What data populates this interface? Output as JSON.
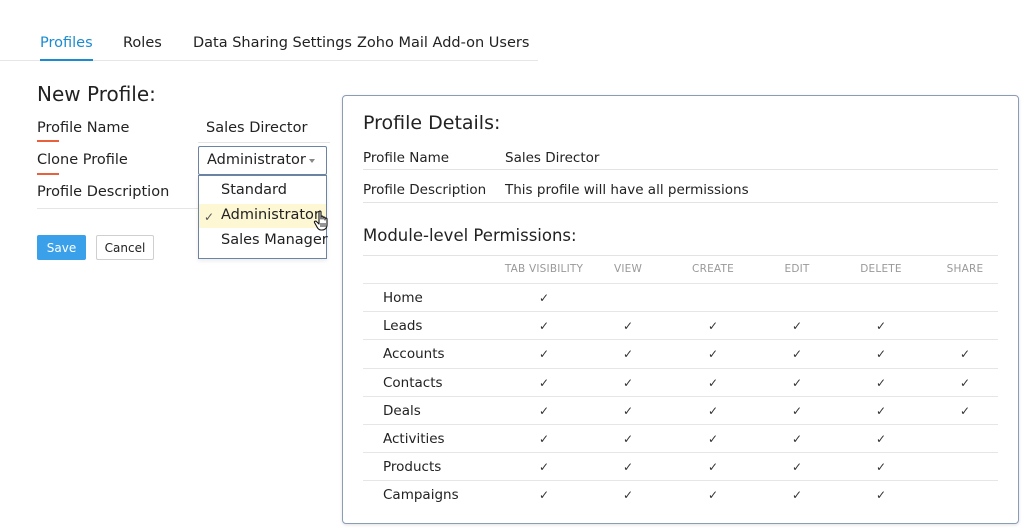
{
  "tabs": [
    {
      "label": "Profiles",
      "active": true
    },
    {
      "label": "Roles",
      "active": false
    },
    {
      "label": "Data Sharing Settings",
      "active": false
    },
    {
      "label": "Zoho Mail Add-on Users",
      "active": false
    }
  ],
  "form": {
    "title": "New Profile:",
    "profile_name_label": "Profile Name",
    "profile_name_value": "Sales Director",
    "clone_label": "Clone Profile",
    "clone_selected": "Administrator",
    "description_label": "Profile Description",
    "options": [
      "Standard",
      "Administrator",
      "Sales Manager"
    ],
    "checked_option": "✓",
    "save_label": "Save",
    "cancel_label": "Cancel"
  },
  "details": {
    "title": "Profile Details:",
    "name_label": "Profile Name",
    "name_value": "Sales Director",
    "desc_label": "Profile Description",
    "desc_value": "This profile will have all permissions",
    "module_title": "Module-level Permissions:",
    "columns": [
      "TAB VISIBILITY",
      "VIEW",
      "CREATE",
      "EDIT",
      "DELETE",
      "SHARE"
    ],
    "rows": [
      {
        "module": "Home",
        "perms": [
          true,
          false,
          false,
          false,
          false,
          false
        ]
      },
      {
        "module": "Leads",
        "perms": [
          true,
          true,
          true,
          true,
          true,
          false
        ]
      },
      {
        "module": "Accounts",
        "perms": [
          true,
          true,
          true,
          true,
          true,
          true
        ]
      },
      {
        "module": "Contacts",
        "perms": [
          true,
          true,
          true,
          true,
          true,
          true
        ]
      },
      {
        "module": "Deals",
        "perms": [
          true,
          true,
          true,
          true,
          true,
          true
        ]
      },
      {
        "module": "Activities",
        "perms": [
          true,
          true,
          true,
          true,
          true,
          false
        ]
      },
      {
        "module": "Products",
        "perms": [
          true,
          true,
          true,
          true,
          true,
          false
        ]
      },
      {
        "module": "Campaigns",
        "perms": [
          true,
          true,
          true,
          true,
          true,
          false
        ]
      }
    ],
    "check_glyph": "✓"
  },
  "colors": {
    "accent": "#1a8bd0",
    "save_button": "#3aa0ea",
    "required_mark": "#e8613c",
    "selected_option_bg": "#fdf7d4"
  },
  "icons": {
    "caret": "chevron-down-icon",
    "cursor": "hand-pointer-icon",
    "check": "check-icon"
  }
}
